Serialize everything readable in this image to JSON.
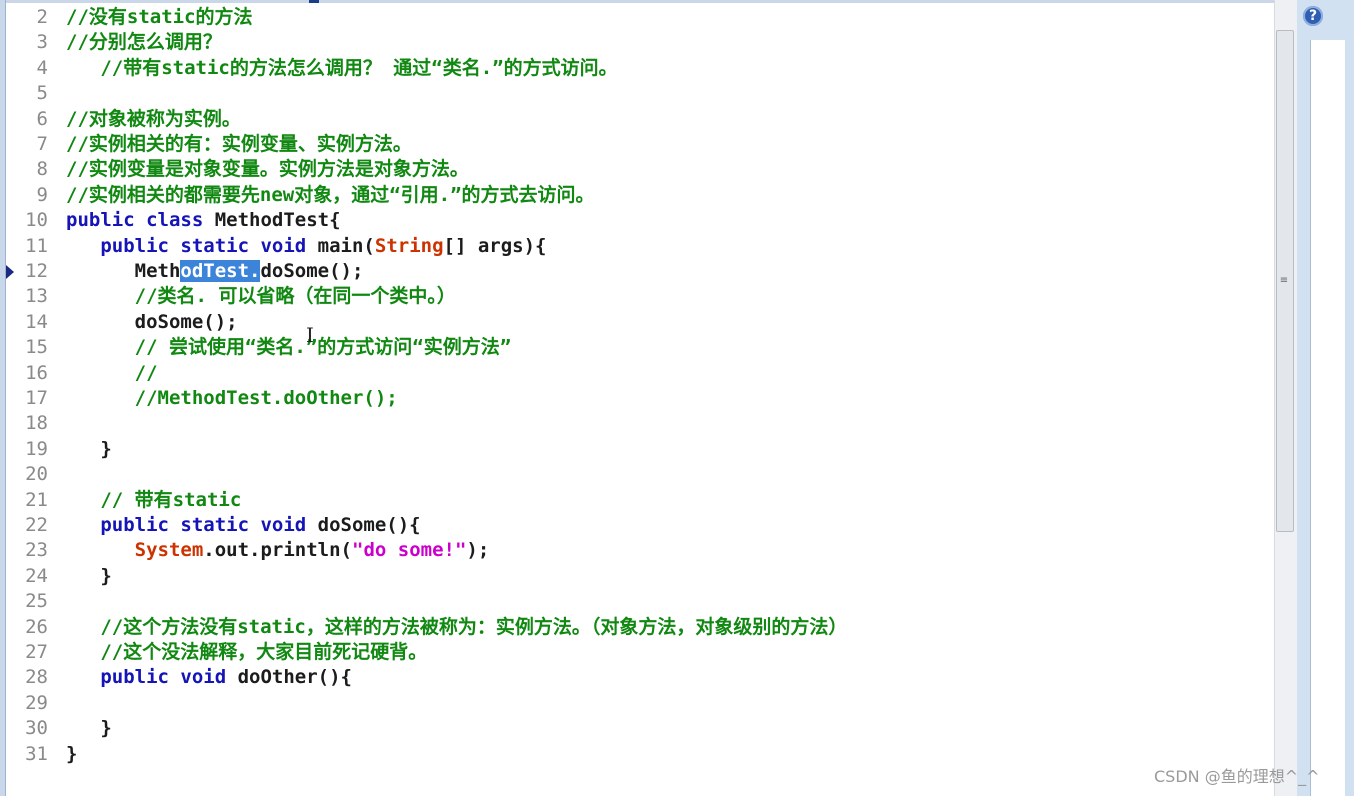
{
  "editor": {
    "lines": [
      {
        "n": "2",
        "segs": [
          {
            "t": "//没有static的方法",
            "c": "cm"
          }
        ]
      },
      {
        "n": "3",
        "segs": [
          {
            "t": "//分别怎么调用？",
            "c": "cm"
          }
        ]
      },
      {
        "n": "4",
        "segs": [
          {
            "t": "   //带有static的方法怎么调用？ 通过“类名.”的方式访问。",
            "c": "cm"
          }
        ]
      },
      {
        "n": "5",
        "segs": []
      },
      {
        "n": "6",
        "segs": [
          {
            "t": "//对象被称为实例。",
            "c": "cm"
          }
        ]
      },
      {
        "n": "7",
        "segs": [
          {
            "t": "//实例相关的有：实例变量、实例方法。",
            "c": "cm"
          }
        ]
      },
      {
        "n": "8",
        "segs": [
          {
            "t": "//实例变量是对象变量。实例方法是对象方法。",
            "c": "cm"
          }
        ]
      },
      {
        "n": "9",
        "segs": [
          {
            "t": "//实例相关的都需要先new对象，通过“引用.”的方式去访问。",
            "c": "cm"
          }
        ]
      },
      {
        "n": "10",
        "segs": [
          {
            "t": "public class ",
            "c": "kw"
          },
          {
            "t": "MethodTest{",
            "c": "pl"
          }
        ]
      },
      {
        "n": "11",
        "segs": [
          {
            "t": "   public static void ",
            "c": "kw"
          },
          {
            "t": "main(",
            "c": "pl"
          },
          {
            "t": "String",
            "c": "ty"
          },
          {
            "t": "[] args){",
            "c": "pl"
          }
        ]
      },
      {
        "n": "12",
        "segs": [
          {
            "t": "      Meth",
            "c": "pl"
          },
          {
            "t": "odTest.",
            "c": "sel"
          },
          {
            "t": "doSome();",
            "c": "pl"
          }
        ],
        "marker": true
      },
      {
        "n": "13",
        "segs": [
          {
            "t": "      //类名. 可以省略（在同一个类中。）",
            "c": "cm"
          }
        ]
      },
      {
        "n": "14",
        "segs": [
          {
            "t": "      doSome();",
            "c": "pl"
          }
        ]
      },
      {
        "n": "15",
        "segs": [
          {
            "t": "      // 尝试使用“类名.”的方式访问“实例方法”",
            "c": "cm"
          }
        ]
      },
      {
        "n": "16",
        "segs": [
          {
            "t": "      //",
            "c": "cm"
          }
        ]
      },
      {
        "n": "17",
        "segs": [
          {
            "t": "      //MethodTest.doOther();",
            "c": "cm"
          }
        ]
      },
      {
        "n": "18",
        "segs": []
      },
      {
        "n": "19",
        "segs": [
          {
            "t": "   }",
            "c": "pl"
          }
        ]
      },
      {
        "n": "20",
        "segs": []
      },
      {
        "n": "21",
        "segs": [
          {
            "t": "   // 带有static",
            "c": "cm"
          }
        ]
      },
      {
        "n": "22",
        "segs": [
          {
            "t": "   public static void ",
            "c": "kw"
          },
          {
            "t": "doSome(){",
            "c": "pl"
          }
        ]
      },
      {
        "n": "23",
        "segs": [
          {
            "t": "      System",
            "c": "ty"
          },
          {
            "t": ".out.println(",
            "c": "pl"
          },
          {
            "t": "\"do some!\"",
            "c": "st"
          },
          {
            "t": ");",
            "c": "pl"
          }
        ]
      },
      {
        "n": "24",
        "segs": [
          {
            "t": "   }",
            "c": "pl"
          }
        ]
      },
      {
        "n": "25",
        "segs": []
      },
      {
        "n": "26",
        "segs": [
          {
            "t": "   //这个方法没有static，这样的方法被称为：实例方法。（对象方法，对象级别的方法）",
            "c": "cm"
          }
        ]
      },
      {
        "n": "27",
        "segs": [
          {
            "t": "   //这个没法解释，大家目前死记硬背。",
            "c": "cm"
          }
        ]
      },
      {
        "n": "28",
        "segs": [
          {
            "t": "   public void ",
            "c": "kw"
          },
          {
            "t": "doOther(){",
            "c": "pl"
          }
        ]
      },
      {
        "n": "29",
        "segs": []
      },
      {
        "n": "30",
        "segs": [
          {
            "t": "   }",
            "c": "pl"
          }
        ]
      },
      {
        "n": "31",
        "segs": [
          {
            "t": "}",
            "c": "pl"
          }
        ]
      }
    ]
  },
  "icons": {
    "help": "help-icon",
    "help_glyph": "?"
  },
  "watermark": "CSDN @鱼的理想^_^"
}
